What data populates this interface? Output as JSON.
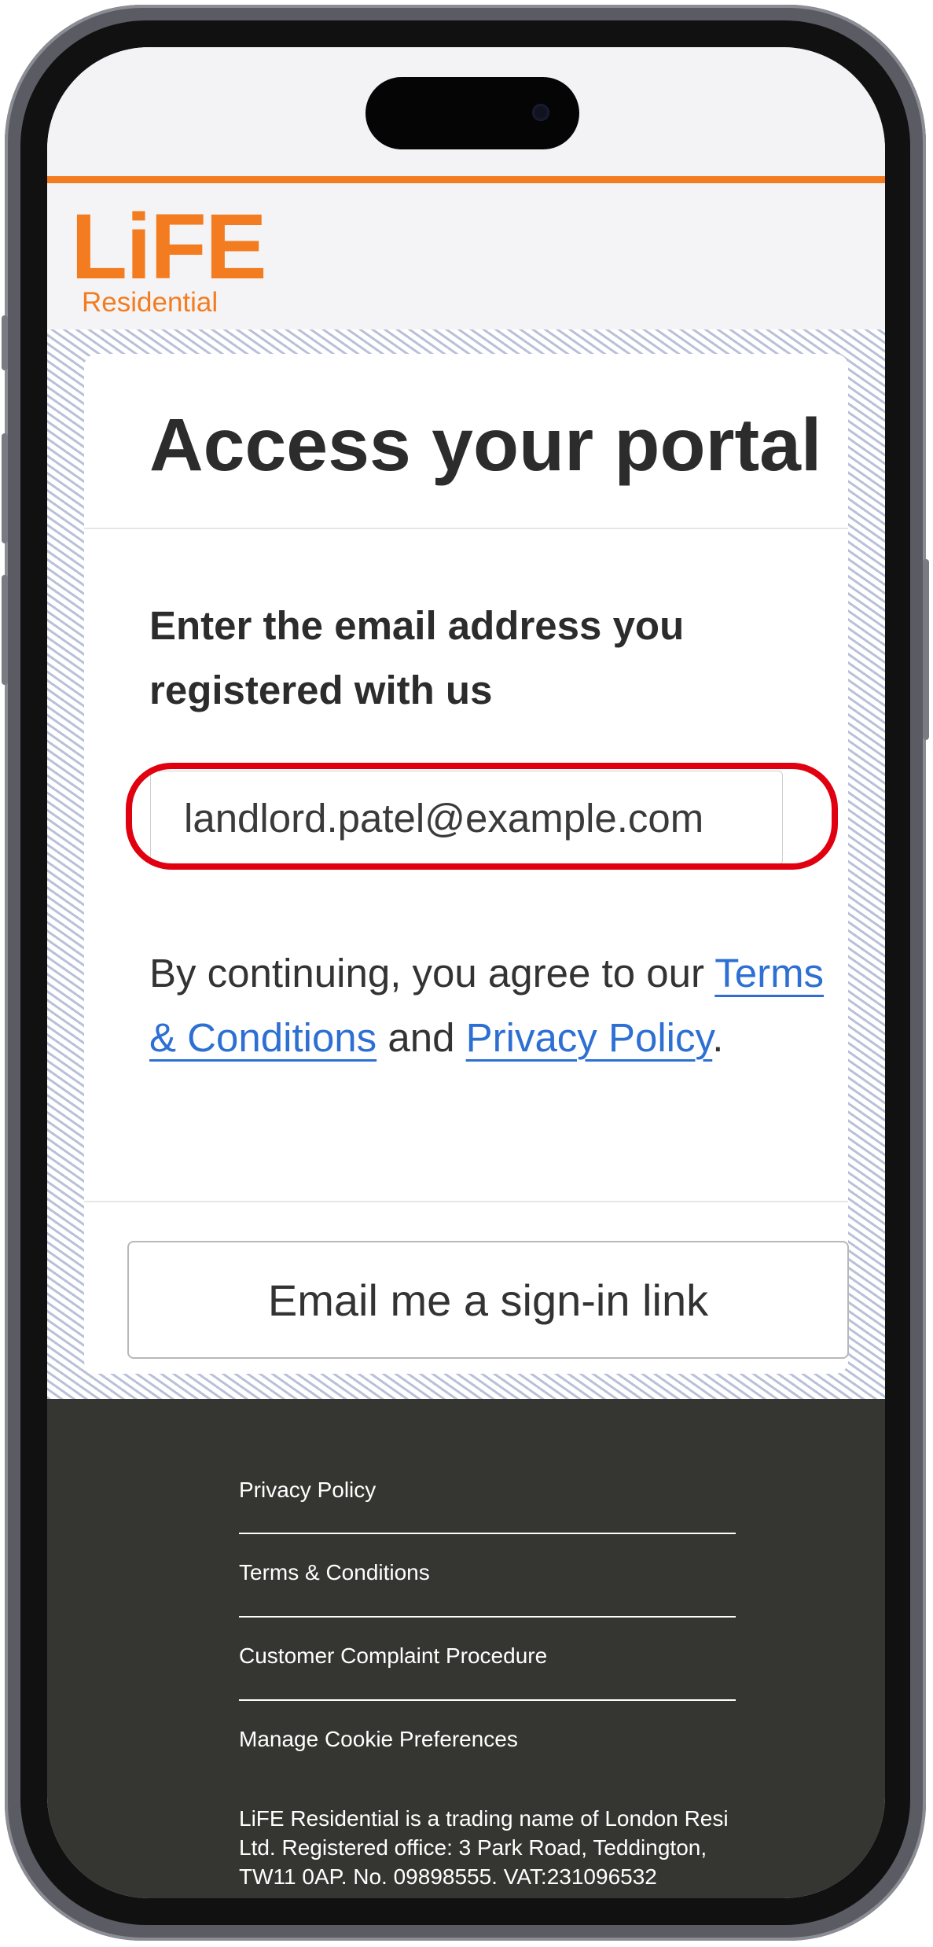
{
  "brand": {
    "logo_text": "LiFE",
    "logo_subtitle": "Residential",
    "accent_color": "#f47c20"
  },
  "login_card": {
    "title": "Access your portal",
    "email_label": "Enter the email address you registered with us",
    "email_value": "landlord.patel@example.com",
    "consent_prefix": "By continuing, you agree to our",
    "terms_link": "Terms & Conditions",
    "consent_and": "and",
    "privacy_link": "Privacy Policy",
    "consent_suffix": ".",
    "submit_label": "Email me a sign-in link"
  },
  "footer": {
    "links": [
      "Privacy Policy",
      "Terms & Conditions",
      "Customer Complaint Procedure",
      "Manage Cookie Preferences"
    ],
    "legal_text": "LiFE Residential is a trading name of London Resi Ltd. Registered office: 3 Park Road, Teddington, TW11 0AP. No. 09898555. VAT:231096532"
  },
  "colors": {
    "link": "#2d6fd3",
    "footer_bg": "#353532",
    "highlight": "#e00010"
  }
}
